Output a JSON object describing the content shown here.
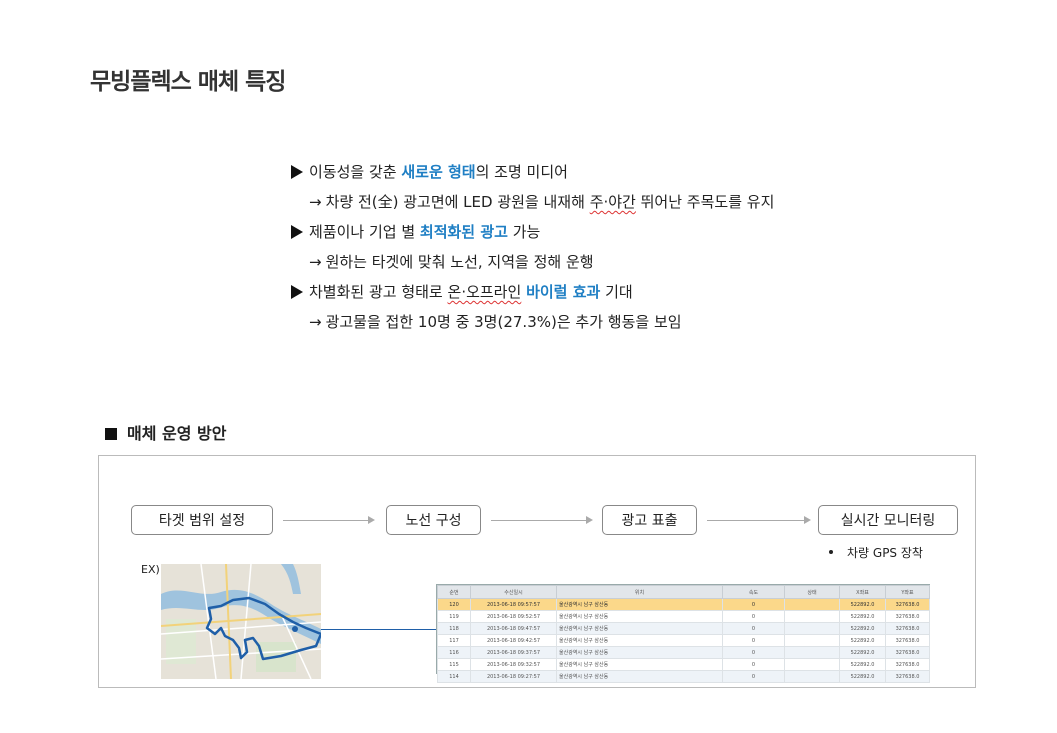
{
  "title": "무빙플렉스 매체 특징",
  "bullets": {
    "b1_pre": "이동성을 갖춘 ",
    "b1_hl": "새로운 형태",
    "b1_post": "의 조명 미디어",
    "s1_pre": "차량 전(全) 광고면에 LED 광원을 내재해 ",
    "s1_wavy": "주·야간",
    "s1_post": " 뛰어난 주목도를 유지",
    "b2_pre": "제품이나 기업 별 ",
    "b2_hl": "최적화된 광고",
    "b2_post": " 가능",
    "s2": "원하는 타겟에 맞춰 노선, 지역을 정해 운행",
    "b3_pre": "차별화된 광고 형태로 ",
    "b3_wavy": "온·오프라인",
    "b3_mid": " ",
    "b3_hl": "바이럴 효과",
    "b3_post": " 기대",
    "s3": "광고물을 접한 10명 중 3명(27.3%)은 추가 행동을 보임",
    "arrow": "→"
  },
  "section": {
    "title": "매체 운영 방안"
  },
  "flow": {
    "step1": "타겟 범위 설정",
    "step2": "노선 구성",
    "step3": "광고 표출",
    "step4": "실시간 모니터링",
    "note": "차량 GPS 장착"
  },
  "example_label": "EX)",
  "gps_table": {
    "headers": [
      "순번",
      "수신일시",
      "위치",
      "속도",
      "상태",
      "X좌표",
      "Y좌표"
    ],
    "rows": [
      [
        "120",
        "2013-06-18 09:57:57",
        "울산광역시 남구 삼산동",
        "0",
        "",
        "522892.0",
        "327638.0"
      ],
      [
        "119",
        "2013-06-18 09:52:57",
        "울산광역시 남구 삼산동",
        "0",
        "",
        "522892.0",
        "327638.0"
      ],
      [
        "118",
        "2013-06-18 09:47:57",
        "울산광역시 남구 삼산동",
        "0",
        "",
        "522892.0",
        "327638.0"
      ],
      [
        "117",
        "2013-06-18 09:42:57",
        "울산광역시 남구 삼산동",
        "0",
        "",
        "522892.0",
        "327638.0"
      ],
      [
        "116",
        "2013-06-18 09:37:57",
        "울산광역시 남구 삼산동",
        "0",
        "",
        "522892.0",
        "327638.0"
      ],
      [
        "115",
        "2013-06-18 09:32:57",
        "울산광역시 남구 삼산동",
        "0",
        "",
        "522892.0",
        "327638.0"
      ],
      [
        "114",
        "2013-06-18 09:27:57",
        "울산광역시 남구 삼산동",
        "0",
        "",
        "522892.0",
        "327638.0"
      ]
    ]
  },
  "colors": {
    "highlight": "#1f7fc4",
    "route": "#1f5fa8",
    "selected_row": "#fbd88a"
  }
}
